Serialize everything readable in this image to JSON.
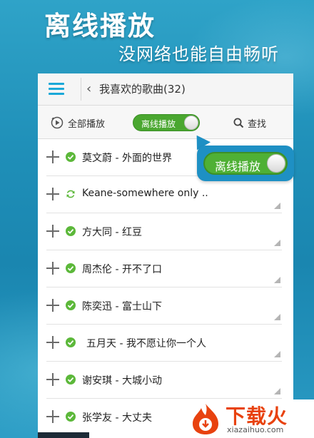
{
  "promo": {
    "title": "离线播放",
    "subtitle": "没网络也能自由畅听"
  },
  "header": {
    "back_icon": "chevron-left-icon",
    "title": "我喜欢的歌曲(32)"
  },
  "toolbar": {
    "play_all_label": "全部播放",
    "offline_toggle_label": "离线播放",
    "offline_toggle_on": true,
    "search_label": "查找"
  },
  "songs": [
    {
      "title": "莫文蔚 - 外面的世界",
      "status": "downloaded"
    },
    {
      "title": "Keane-somewhere only ..",
      "status": "syncing"
    },
    {
      "title": "方大同 - 红豆",
      "status": "downloaded"
    },
    {
      "title": "周杰伦 - 开不了口",
      "status": "downloaded"
    },
    {
      "title": "陈奕迅 - 富士山下",
      "status": "downloaded"
    },
    {
      "title": "五月天 - 我不愿让你一个人",
      "status": "downloaded"
    },
    {
      "title": "谢安琪 - 大城小动",
      "status": "downloaded"
    },
    {
      "title": "张学友 - 大丈夫",
      "status": "downloaded"
    }
  ],
  "callout": {
    "label": "离线播放",
    "on": true
  },
  "watermark": {
    "brand": "下载火",
    "domain": "xiazaihuo.com"
  },
  "colors": {
    "accent_blue": "#1aa8d8",
    "toggle_green": "#4aa730",
    "callout_blue": "#1e90c4",
    "watermark_red": "#e8420f"
  }
}
